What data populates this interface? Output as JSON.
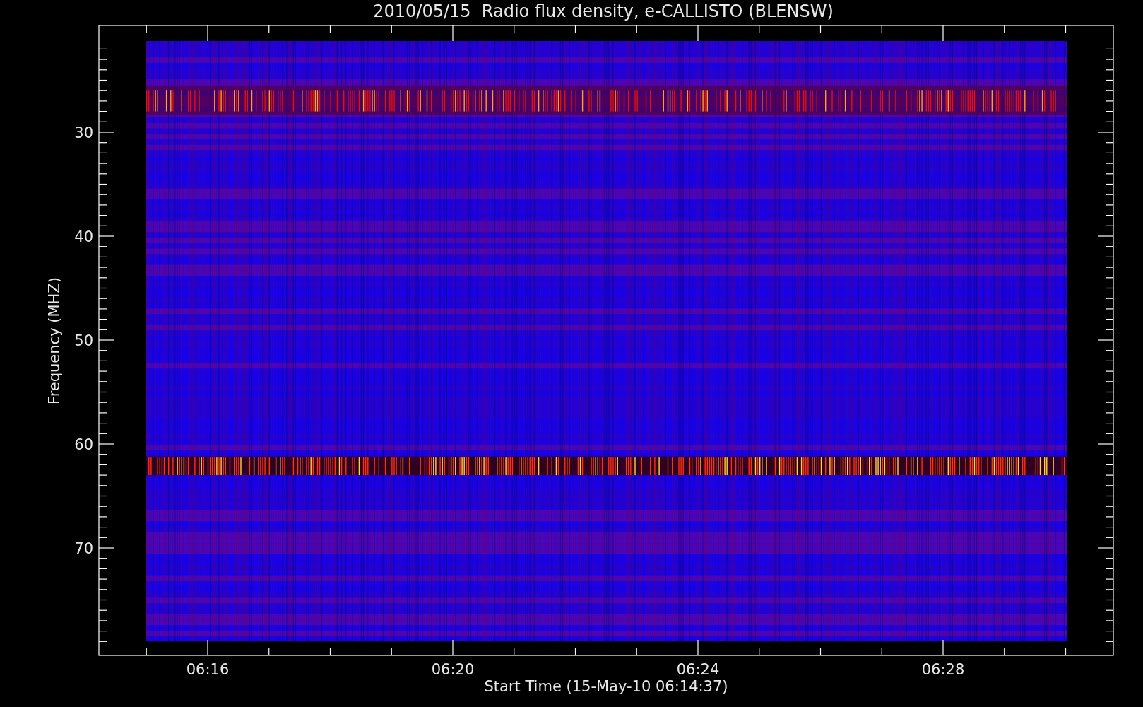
{
  "title": "2010/05/15  Radio flux density, e-CALLISTO (BLENSW)",
  "ylabel": "Frequency (MHZ)",
  "xlabel": "Start Time (15-May-10 06:14:37)",
  "yticks": [
    "30",
    "40",
    "50",
    "60",
    "70"
  ],
  "xticks": [
    "06:16",
    "06:20",
    "06:24",
    "06:28"
  ]
}
